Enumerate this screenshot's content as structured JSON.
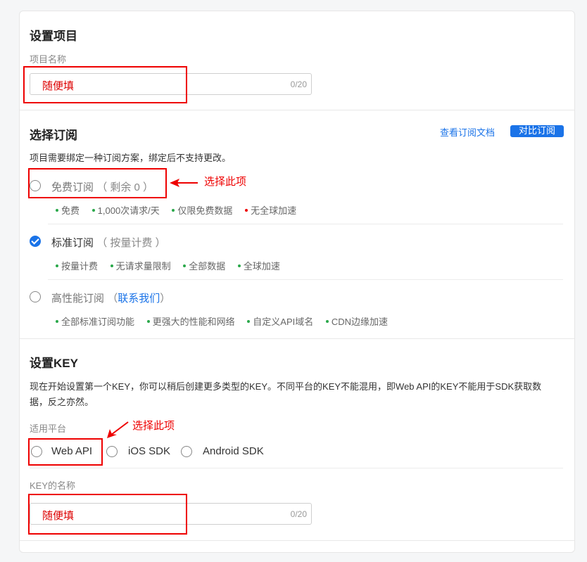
{
  "project": {
    "title": "设置项目",
    "name_label": "项目名称",
    "name_value": "随便填",
    "name_count": "0/20"
  },
  "subscription": {
    "title": "选择订阅",
    "view_docs": "查看订阅文档",
    "compare": "对比订阅",
    "description": "项目需要绑定一种订阅方案，绑定后不支持更改。",
    "annotation": "选择此项",
    "plans": [
      {
        "name": "免费订阅",
        "extra": "（ 剩余 0 ）",
        "features": [
          "免费",
          "1,000次请求/天",
          "仅限免费数据",
          "无全球加速"
        ]
      },
      {
        "name": "标准订阅",
        "extra": "（ 按量计费 ）",
        "features": [
          "按量计费",
          "无请求量限制",
          "全部数据",
          "全球加速"
        ]
      },
      {
        "name": "高性能订阅",
        "extra_open": "（",
        "extra_link": "联系我们",
        "extra_close": "）",
        "features": [
          "全部标准订阅功能",
          "更强大的性能和网络",
          "自定义API域名",
          "CDN边缘加速"
        ]
      }
    ]
  },
  "key": {
    "title": "设置KEY",
    "description": "现在开始设置第一个KEY，你可以稍后创建更多类型的KEY。不同平台的KEY不能混用，即Web API的KEY不能用于SDK获取数据，反之亦然。",
    "platform_label": "适用平台",
    "annotation": "选择此项",
    "platforms": [
      "Web API",
      "iOS SDK",
      "Android SDK"
    ],
    "name_label": "KEY的名称",
    "name_value": "随便填",
    "name_count": "0/20"
  },
  "colors": {
    "accent": "#1a73e8",
    "annotation": "#ee0000",
    "feature_dot": "#2aa84a"
  }
}
